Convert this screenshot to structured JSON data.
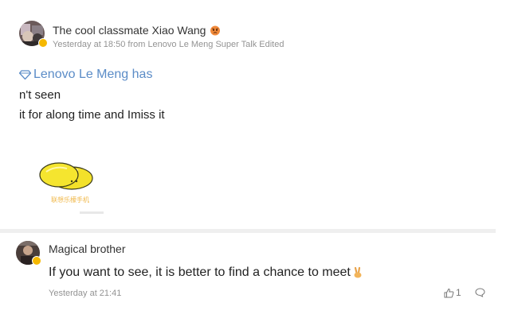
{
  "post": {
    "author_name": "The cool classmate Xiao Wang",
    "meta": "Yesterday at 18:50 from Lenovo Le Meng Super Talk Edited",
    "topic_tag": "Lenovo Le Meng has",
    "body_lines": [
      "n't seen",
      "it for along time and Imiss it"
    ],
    "sticker": {
      "icon": "lemon-sticker",
      "caption": "联想乐檬手机"
    }
  },
  "comment": {
    "author_name": "Magical brother",
    "text": "If you want to see, it is better to find a chance to meet",
    "time": "Yesterday at 21:41",
    "like_count": "1"
  },
  "colors": {
    "topic_link": "#5b8cc7",
    "meta_gray": "#939393",
    "badge_yellow": "#f5b800",
    "divider": "#efefef"
  }
}
